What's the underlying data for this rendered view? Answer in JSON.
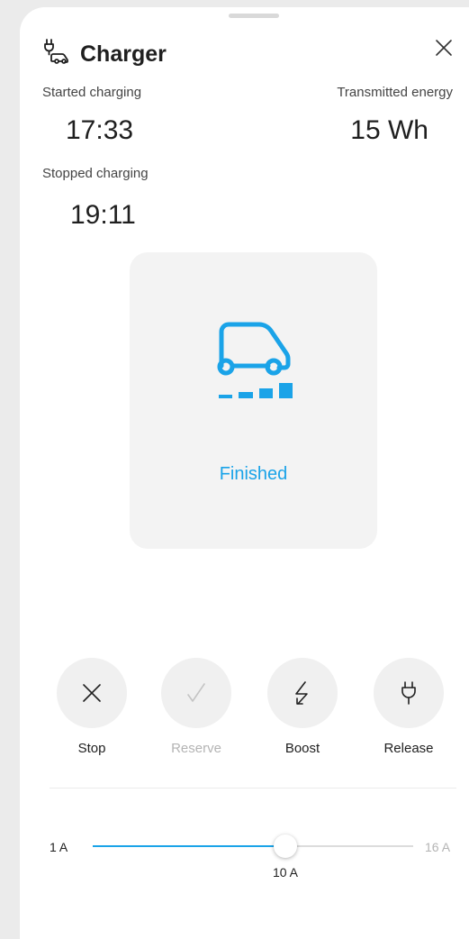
{
  "header": {
    "title": "Charger",
    "icon": "plug-car-icon",
    "close_icon": "close-icon"
  },
  "stats": {
    "started_label": "Started charging",
    "started_value": "17:33",
    "energy_label": "Transmitted energy",
    "energy_value": "15 Wh",
    "stopped_label": "Stopped charging",
    "stopped_value": "19:11"
  },
  "status": {
    "text": "Finished",
    "icon": "car-charging-icon",
    "color": "#1aa3e8"
  },
  "actions": [
    {
      "label": "Stop",
      "icon": "close-icon",
      "enabled": true
    },
    {
      "label": "Reserve",
      "icon": "check-icon",
      "enabled": false
    },
    {
      "label": "Boost",
      "icon": "lightning-icon",
      "enabled": true
    },
    {
      "label": "Release",
      "icon": "plug-icon",
      "enabled": true
    }
  ],
  "current_slider": {
    "min_label": "1 A",
    "max_label": "16 A",
    "value_label": "10 A",
    "min": 1,
    "max": 16,
    "value": 10
  }
}
